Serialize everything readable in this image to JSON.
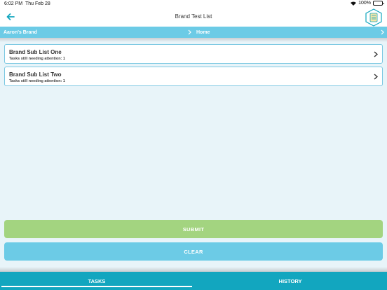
{
  "status": {
    "time": "6:02 PM",
    "date": "Thu Feb 28",
    "battery": "100%"
  },
  "nav": {
    "title": "Brand Test List",
    "back_icon": "arrow-left-icon",
    "logo_icon": "hexagon-clipboard-logo"
  },
  "breadcrumb": {
    "items": [
      {
        "label": "Aaron's Brand"
      },
      {
        "label": "Home"
      }
    ]
  },
  "lists": [
    {
      "title": "Brand Sub List One",
      "subtitle": "Tasks still needing attention: 1"
    },
    {
      "title": "Brand Sub List Two",
      "subtitle": "Tasks still needing attention: 1"
    }
  ],
  "actions": {
    "submit_label": "SUBMIT",
    "clear_label": "CLEAR"
  },
  "tabs": [
    {
      "label": "TASKS",
      "active": true
    },
    {
      "label": "HISTORY",
      "active": false
    }
  ],
  "colors": {
    "accent": "#12a6bf",
    "breadcrumb": "#6ccbe6",
    "submit": "#a3d480",
    "background": "#e8f4f9"
  }
}
